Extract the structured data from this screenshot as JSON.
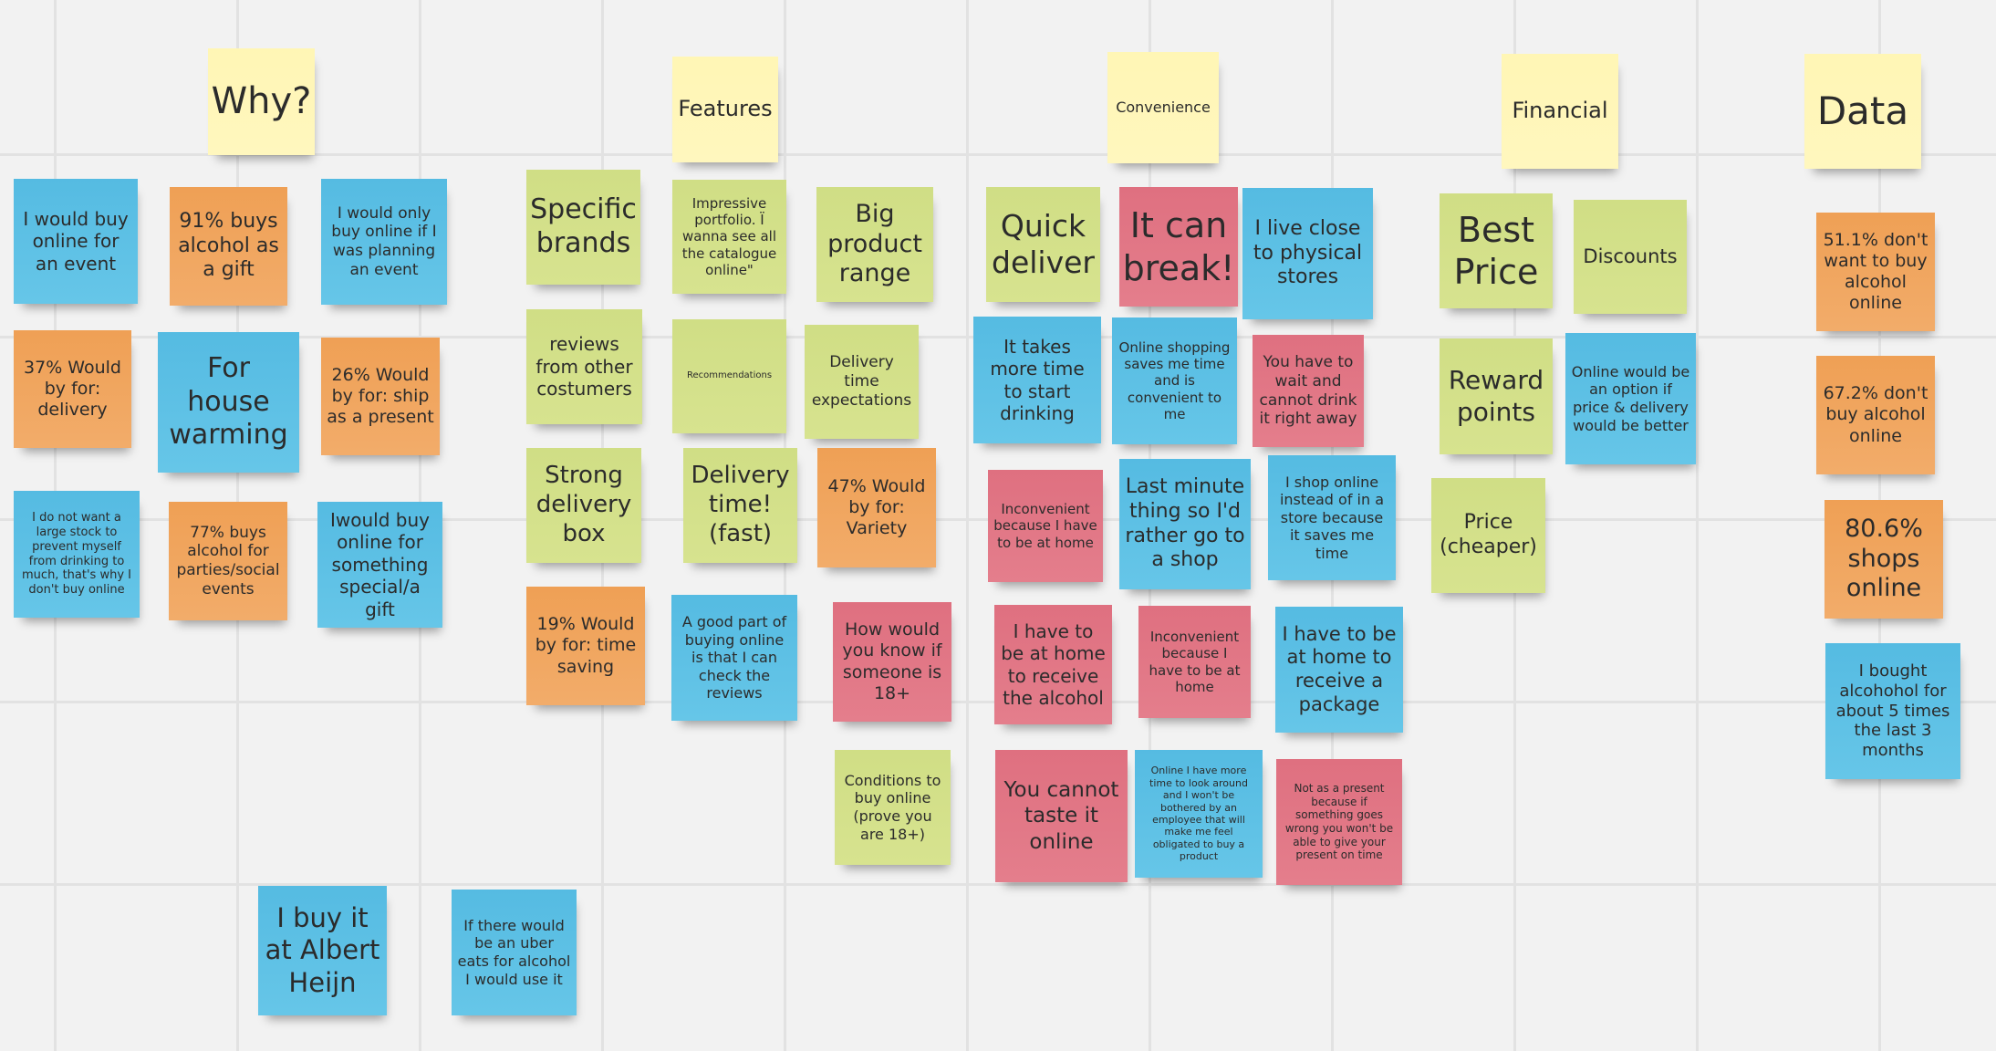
{
  "board": {
    "colors": {
      "background": "#f2f2f2",
      "grid": "#e2e2e2",
      "yellow": "#fff6b5",
      "green": "#d3e08a",
      "blue": "#5ebfe5",
      "orange": "#f0a55e",
      "red": "#e27785"
    },
    "headers": {
      "why": "Why?",
      "features": "Features",
      "convenience": "Convenience",
      "financial": "Financial",
      "data": "Data"
    },
    "why": [
      "I would buy online for an event",
      "91% buys alcohol as a gift",
      "I would only buy online if I was planning an event",
      "37%  Would by for: delivery",
      "For house warming",
      "26%  Would by for: ship as a present",
      "I do not want a large stock to prevent myself from drinking to much, that's why I don't buy online",
      "77% buys alcohol  for parties/social events",
      "Iwould buy online for something special/a gift",
      "I buy it at Albert Heijn",
      "If there would be an uber eats for alcohol I would use it"
    ],
    "features": [
      "Specific brands",
      "Impressive portfolio. Ï wanna see all the catalogue online\"",
      "Big product range",
      "reviews from other costumers",
      "Recommendations",
      "Delivery time expectations",
      "Strong delivery box",
      "Delivery time! (fast)",
      "47% Would by for: Variety",
      "19%  Would by for: time saving",
      "A good part of buying online is that I can check the reviews",
      "How would you know if someone is 18+",
      "Conditions to buy online (prove you are 18+)"
    ],
    "convenience": [
      "Quick deliver",
      "It can break!",
      "I live close to physical stores",
      "It takes more time to start drinking",
      "Online shopping saves me time and is convenient to me",
      "You have to wait and cannot drink it right away",
      "Inconvenient because I have to be at home",
      "Last minute thing so I'd rather go to a shop",
      "I shop online instead of in a store because it saves me time",
      "I have to be at home to receive the alcohol",
      "Inconvenient because I have to be at home",
      "I have to be at home to receive a package",
      "You cannot taste it online",
      "Online I have more time to look around and I won't be bothered by an employee that will make me feel obligated to buy a product",
      "Not as a present because if something goes wrong you won't be able to give your present on time"
    ],
    "financial": [
      "Best Price",
      "Discounts",
      "Reward points",
      "Online would be an option if price & delivery would be better",
      "Price (cheaper)"
    ],
    "data": [
      "51.1% don't want to buy alcohol online",
      "67.2% don't buy alcohol online",
      "80.6% shops online",
      "I bought alcohohol for about 5 times the last 3 months"
    ]
  }
}
